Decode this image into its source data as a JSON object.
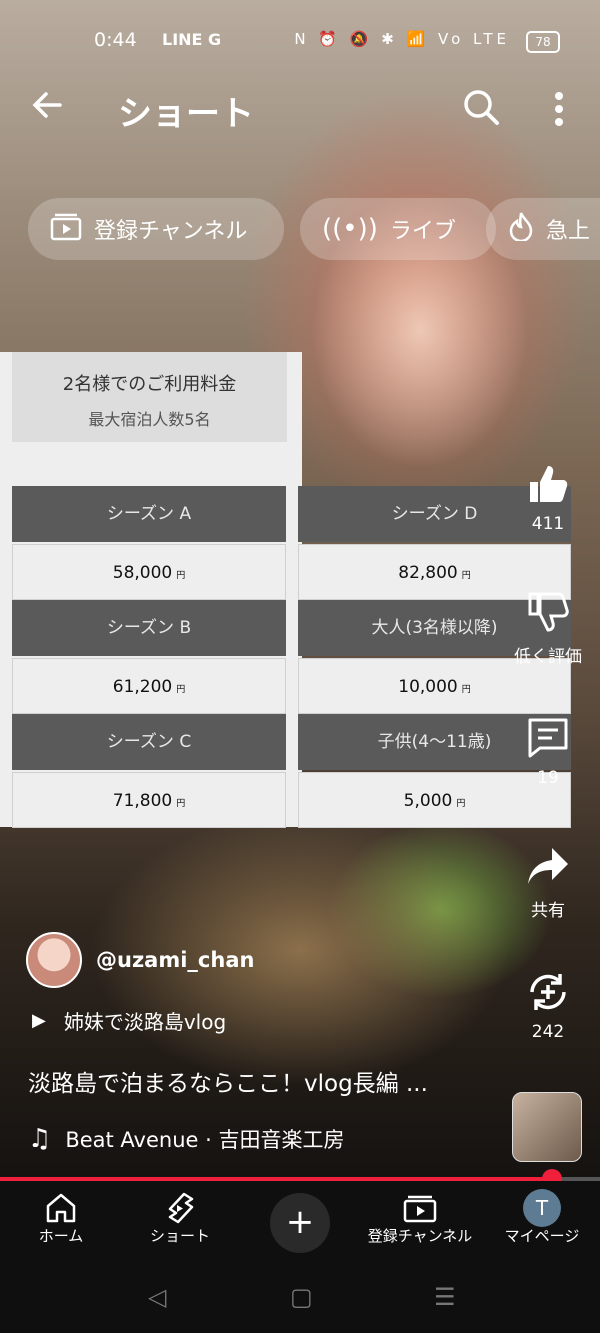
{
  "status_bar": {
    "time": "0:44",
    "left_icons": "LINE G",
    "right_icons": "N ⏰ 🔕 ✱ 📶 Vo LTE",
    "battery": "78"
  },
  "header": {
    "title": "ショート"
  },
  "chips": [
    {
      "label": "登録チャンネル",
      "icon": "subscriptions-icon"
    },
    {
      "label": "ライブ",
      "icon": "live-icon"
    },
    {
      "label": "急上",
      "icon": "trending-icon"
    }
  ],
  "price_table": {
    "title": "2名様でのご利用料金",
    "subtitle": "最大宿泊人数5名",
    "unit": "円",
    "left": [
      {
        "label": "シーズン A",
        "value": "58,000"
      },
      {
        "label": "シーズン B",
        "value": "61,200"
      },
      {
        "label": "シーズン C",
        "value": "71,800"
      }
    ],
    "right": [
      {
        "label": "シーズン D",
        "value": "82,800"
      },
      {
        "label": "大人(3名様以降)",
        "value": "10,000"
      },
      {
        "label": "子供(4〜11歳)",
        "value": "5,000"
      }
    ]
  },
  "actions": {
    "like_count": "411",
    "dislike_label": "低く評価",
    "comment_count": "19",
    "share_label": "共有",
    "remix_count": "242"
  },
  "video": {
    "channel": "@uzami_chan",
    "playlist": "姉妹で淡路島vlog",
    "title": "淡路島で泊まるならここ！vlog長編 ...",
    "music": "Beat Avenue · 吉田音楽工房",
    "progress_fraction": 0.92
  },
  "bottom_nav": {
    "home": "ホーム",
    "shorts": "ショート",
    "subscriptions": "登録チャンネル",
    "my_page": "マイページ",
    "avatar_letter": "T"
  },
  "colors": {
    "accent": "#f0203c",
    "nav_bg": "#0f0f0f",
    "table_header": "#5a5a5a"
  }
}
